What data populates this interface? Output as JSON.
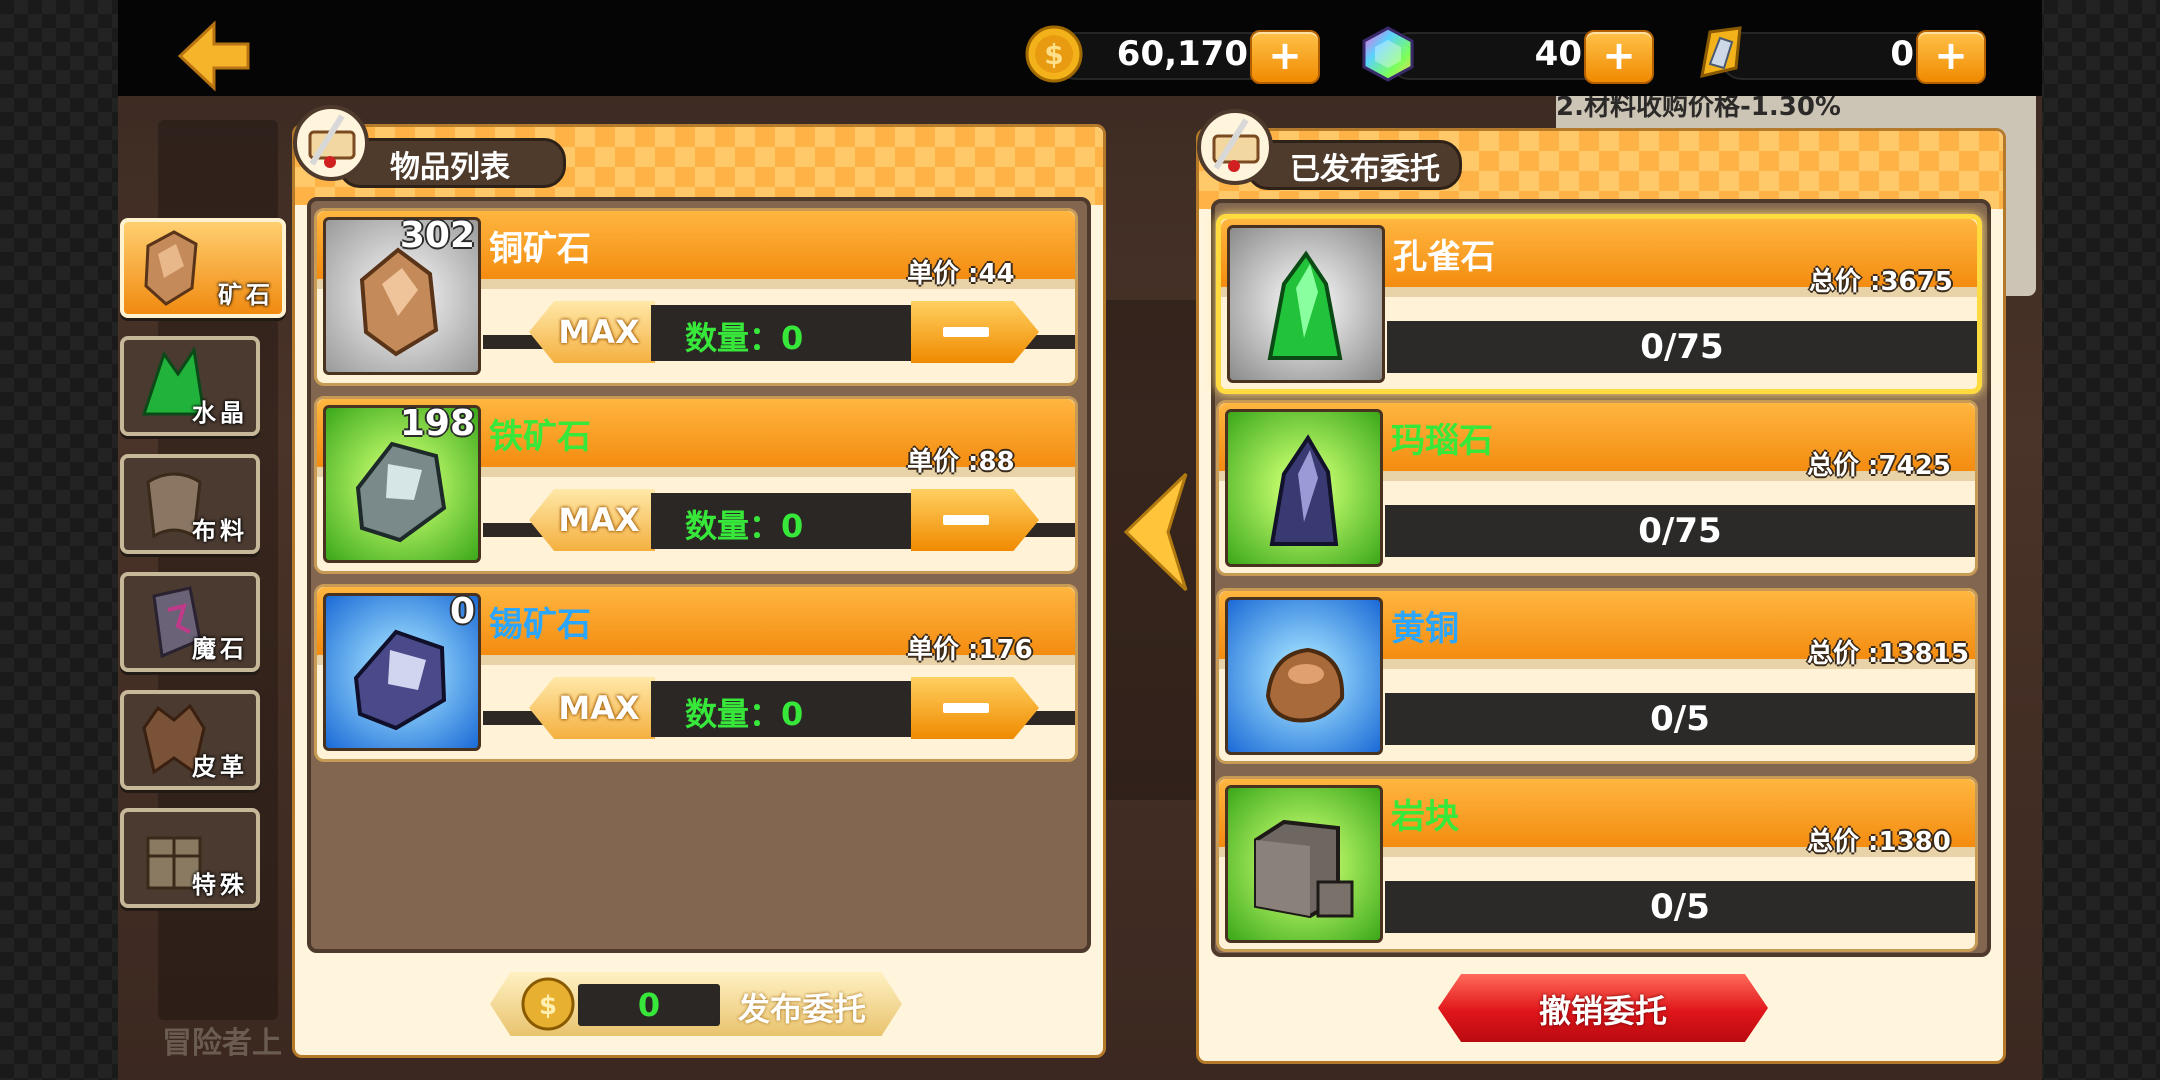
{
  "topbar": {
    "back_icon": "back-arrow-icon",
    "gold": {
      "icon": "gold-coin-icon",
      "value": "60,170",
      "add_label": "+"
    },
    "gem": {
      "icon": "rainbow-gem-icon",
      "value": "40",
      "add_label": "+"
    },
    "ticket": {
      "icon": "crystal-token-icon",
      "value": "0",
      "add_label": "+"
    }
  },
  "categories": [
    {
      "label": "矿石",
      "icon": "ore-icon",
      "active": true
    },
    {
      "label": "水晶",
      "icon": "crystal-icon",
      "active": false
    },
    {
      "label": "布料",
      "icon": "cloth-icon",
      "active": false
    },
    {
      "label": "魔石",
      "icon": "magic-stone-icon",
      "active": false
    },
    {
      "label": "皮革",
      "icon": "leather-icon",
      "active": false
    },
    {
      "label": "特殊",
      "icon": "special-crate-icon",
      "active": false
    }
  ],
  "item_list": {
    "title": "物品列表",
    "items": [
      {
        "name": "铜矿石",
        "name_color": "#ffffff",
        "owned": "302",
        "price": "单价 :44",
        "max_label": "MAX",
        "qty": "数量：0",
        "icon": "copper-ore-icon"
      },
      {
        "name": "铁矿石",
        "name_color": "#37e83b",
        "owned": "198",
        "price": "单价 :88",
        "max_label": "MAX",
        "qty": "数量：0",
        "icon": "iron-ore-icon"
      },
      {
        "name": "锡矿石",
        "name_color": "#2aa6ff",
        "owned": "0",
        "price": "单价 :176",
        "max_label": "MAX",
        "qty": "数量：0",
        "icon": "tin-ore-icon"
      }
    ],
    "publish_amount": "0",
    "publish_label": "发布委托"
  },
  "published": {
    "title": "已发布委托",
    "items": [
      {
        "name": "孔雀石",
        "name_color": "#ffffff",
        "total": "总价 :3675",
        "progress": "0/75",
        "icon": "malachite-icon",
        "selected": true
      },
      {
        "name": "玛瑙石",
        "name_color": "#37e83b",
        "total": "总价 :7425",
        "progress": "0/75",
        "icon": "agate-icon",
        "selected": false
      },
      {
        "name": "黄铜",
        "name_color": "#2aa6ff",
        "total": "总价 :13815",
        "progress": "0/5",
        "icon": "brass-icon",
        "selected": false
      },
      {
        "name": "岩块",
        "name_color": "#37e83b",
        "total": "总价 :1380",
        "progress": "0/5",
        "icon": "rock-block-icon",
        "selected": false
      }
    ],
    "cancel_label": "撤销委托"
  },
  "background": {
    "note_text": "2.材料收购价格-1.30%",
    "bottom_hint": "冒险者上"
  },
  "colors": {
    "accent_orange": "#f49a1a",
    "green_text": "#37e83b",
    "blue_text": "#2aa6ff",
    "cancel_red": "#e0161a"
  }
}
